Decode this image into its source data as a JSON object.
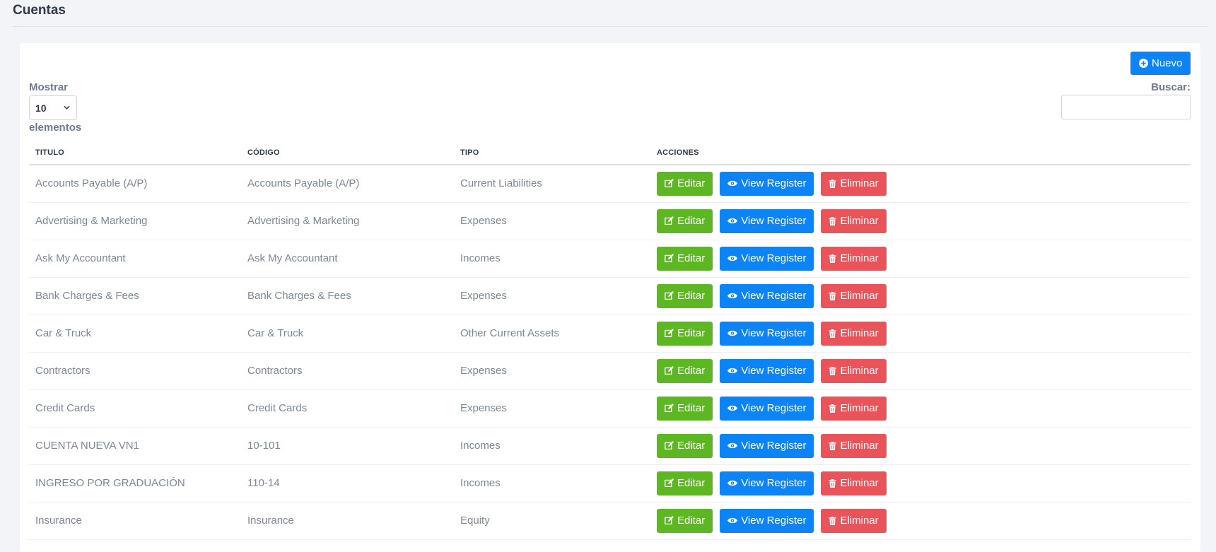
{
  "page": {
    "title": "Cuentas"
  },
  "toolbar": {
    "new_label": "Nuevo"
  },
  "length": {
    "prefix": "Mostrar",
    "selected": "10",
    "suffix": "elementos"
  },
  "search": {
    "label": "Buscar:",
    "value": "",
    "placeholder": ""
  },
  "table": {
    "columns": [
      "TITULO",
      "CÓDIGO",
      "TIPO",
      "ACCIONES"
    ],
    "actions": {
      "edit": "Editar",
      "view": "View Register",
      "delete": "Eliminar"
    },
    "rows": [
      [
        "Accounts Payable (A/P)",
        "Accounts Payable (A/P)",
        "Current Liabilities"
      ],
      [
        "Advertising & Marketing",
        "Advertising & Marketing",
        "Expenses"
      ],
      [
        "Ask My Accountant",
        "Ask My Accountant",
        "Incomes"
      ],
      [
        "Bank Charges & Fees",
        "Bank Charges & Fees",
        "Expenses"
      ],
      [
        "Car & Truck",
        "Car & Truck",
        "Other Current Assets"
      ],
      [
        "Contractors",
        "Contractors",
        "Expenses"
      ],
      [
        "Credit Cards",
        "Credit Cards",
        "Expenses"
      ],
      [
        "CUENTA NUEVA VN1",
        "10-101",
        "Incomes"
      ],
      [
        "INGRESO POR GRADUACIÓN",
        "110-14",
        "Incomes"
      ],
      [
        "Insurance",
        "Insurance",
        "Equity"
      ]
    ]
  },
  "colors": {
    "primary": "#0d84f5",
    "success": "#5cb722",
    "danger": "#e8545a"
  },
  "icons": {
    "new": "plus-circle-icon",
    "edit": "edit-icon",
    "view": "eye-icon",
    "delete": "trash-icon",
    "select": "chevron-down-icon"
  }
}
